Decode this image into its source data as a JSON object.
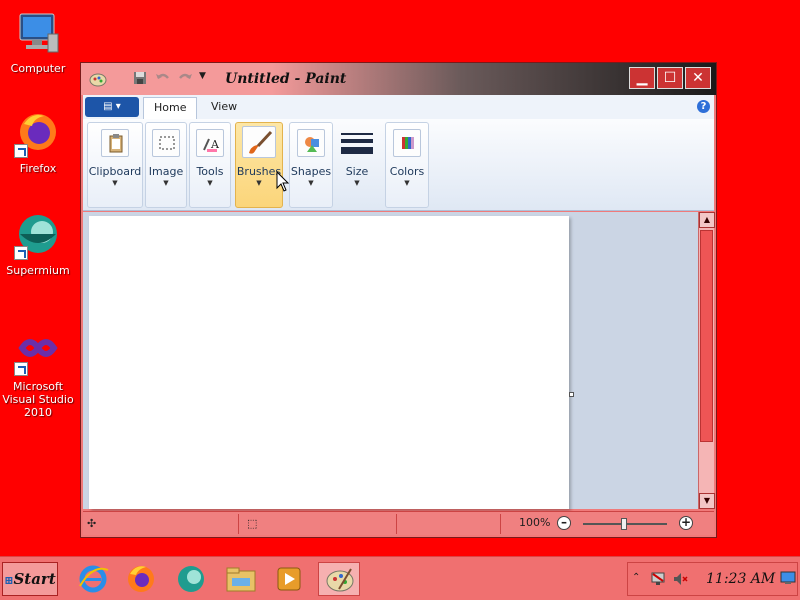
{
  "desktop": {
    "icons": [
      {
        "label": "Computer"
      },
      {
        "label": "Firefox"
      },
      {
        "label": "Supermium"
      },
      {
        "label": "Microsoft Visual Studio 2010"
      }
    ]
  },
  "window": {
    "title": "Untitled - Paint",
    "tabs": [
      {
        "label": "Home"
      },
      {
        "label": "View"
      }
    ],
    "help_glyph": "?",
    "ribbon_groups": [
      {
        "label": "Clipboard"
      },
      {
        "label": "Image"
      },
      {
        "label": "Tools"
      },
      {
        "label": "Brushes"
      },
      {
        "label": "Shapes"
      },
      {
        "label": "Size"
      },
      {
        "label": "Colors"
      }
    ],
    "status": {
      "zoom": "100%"
    }
  },
  "taskbar": {
    "start_label": "Start",
    "clock": "11:23 AM"
  },
  "colors": {
    "desktop": "#ff0000",
    "window_frame": "#f07a7a",
    "hover_highlight": "#fbd57a"
  }
}
